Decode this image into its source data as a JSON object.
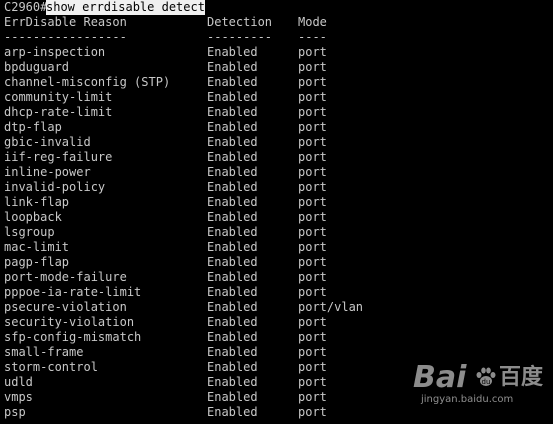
{
  "prompt": {
    "host": "C2960#",
    "command": "show errdisable detect"
  },
  "table": {
    "headers": [
      "ErrDisable Reason",
      "Detection",
      "Mode"
    ],
    "separators": [
      "-----------------",
      "---------",
      "----"
    ],
    "rows": [
      [
        "arp-inspection",
        "Enabled",
        "port"
      ],
      [
        "bpduguard",
        "Enabled",
        "port"
      ],
      [
        "channel-misconfig (STP)",
        "Enabled",
        "port"
      ],
      [
        "community-limit",
        "Enabled",
        "port"
      ],
      [
        "dhcp-rate-limit",
        "Enabled",
        "port"
      ],
      [
        "dtp-flap",
        "Enabled",
        "port"
      ],
      [
        "gbic-invalid",
        "Enabled",
        "port"
      ],
      [
        "iif-reg-failure",
        "Enabled",
        "port"
      ],
      [
        "inline-power",
        "Enabled",
        "port"
      ],
      [
        "invalid-policy",
        "Enabled",
        "port"
      ],
      [
        "link-flap",
        "Enabled",
        "port"
      ],
      [
        "loopback",
        "Enabled",
        "port"
      ],
      [
        "lsgroup",
        "Enabled",
        "port"
      ],
      [
        "mac-limit",
        "Enabled",
        "port"
      ],
      [
        "pagp-flap",
        "Enabled",
        "port"
      ],
      [
        "port-mode-failure",
        "Enabled",
        "port"
      ],
      [
        "pppoe-ia-rate-limit",
        "Enabled",
        "port"
      ],
      [
        "psecure-violation",
        "Enabled",
        "port/vlan"
      ],
      [
        "security-violation",
        "Enabled",
        "port"
      ],
      [
        "sfp-config-mismatch",
        "Enabled",
        "port"
      ],
      [
        "small-frame",
        "Enabled",
        "port"
      ],
      [
        "storm-control",
        "Enabled",
        "port"
      ],
      [
        "udld",
        "Enabled",
        "port"
      ],
      [
        "vmps",
        "Enabled",
        "port"
      ],
      [
        "psp",
        "Enabled",
        "port"
      ]
    ]
  },
  "watermark": {
    "logo_left": "Bai",
    "logo_right": "百度",
    "url": "jingyan.baidu.com",
    "paw_icon": "baidu-paw-icon"
  },
  "colors": {
    "background": "#000000",
    "text": "#c8c8c8",
    "command_highlight_bg": "#f0f0f0",
    "command_highlight_fg": "#000000"
  }
}
